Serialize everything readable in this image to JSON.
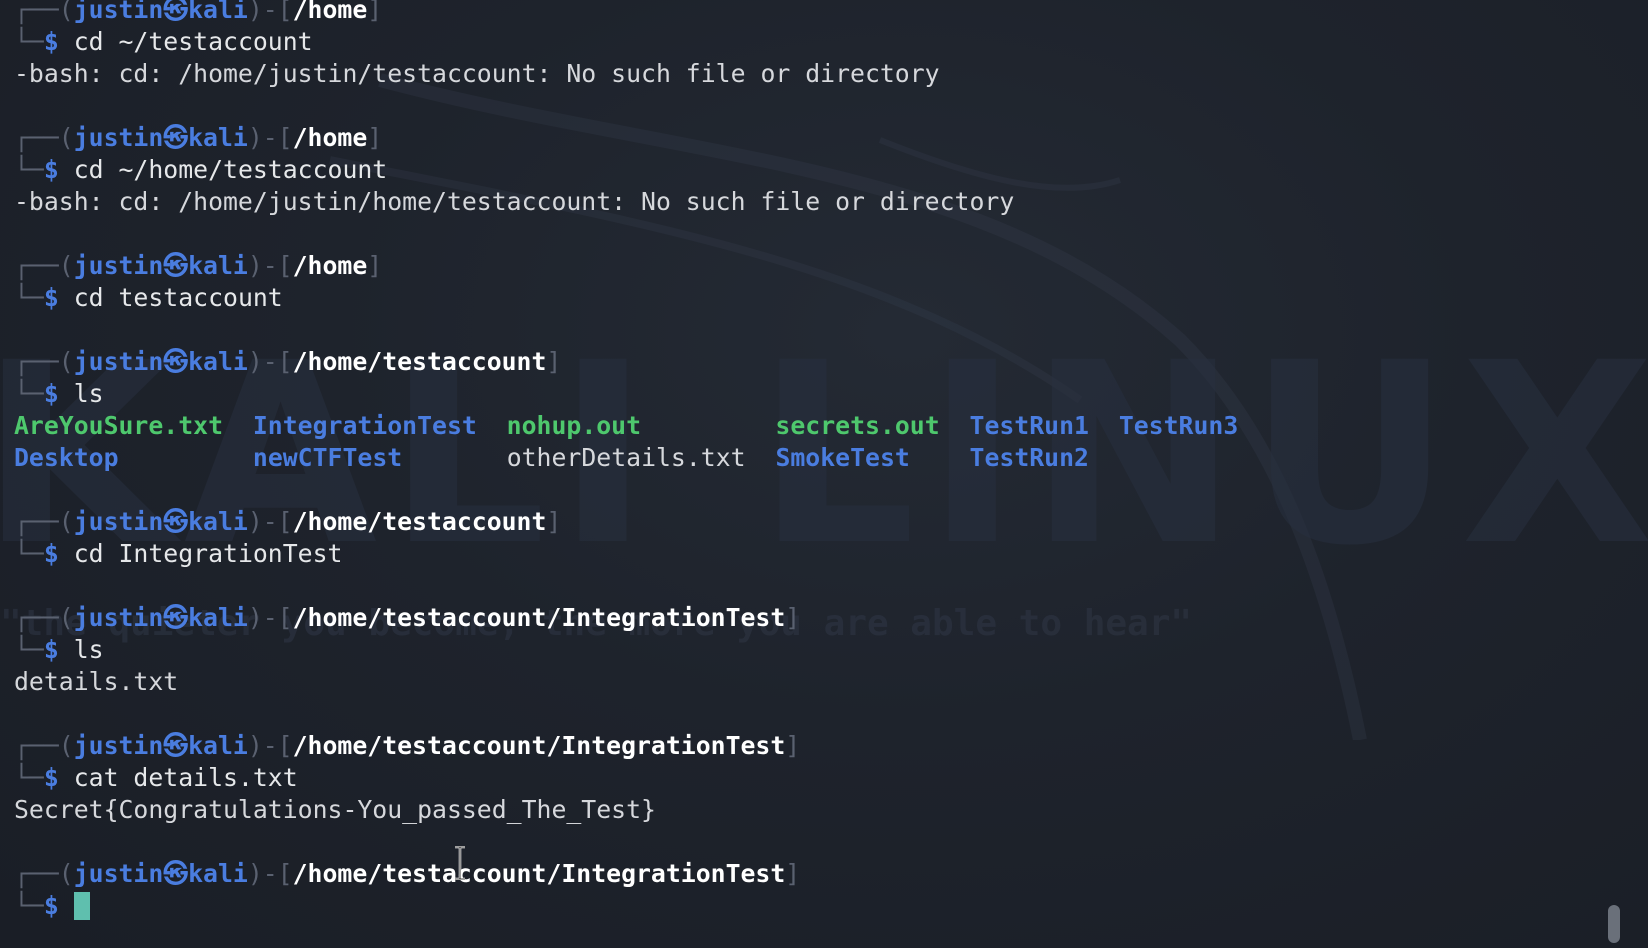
{
  "watermark": {
    "logo_text": "KALI LINUX",
    "quote": "\"the quieter you become, the more you are able to hear\""
  },
  "prompt": {
    "user": "justin",
    "at_symbol": "㉿",
    "host": "kali"
  },
  "blocks": [
    {
      "path": "/home",
      "command": "cd ~/testaccount",
      "output": [
        "-bash: cd: /home/justin/testaccount: No such file or directory"
      ]
    },
    {
      "path": "/home",
      "command": "cd ~/home/testaccount",
      "output": [
        "-bash: cd: /home/justin/home/testaccount: No such file or directory"
      ]
    },
    {
      "path": "/home",
      "command": "cd testaccount",
      "output": []
    },
    {
      "path": "/home/testaccount",
      "command": "ls",
      "output": []
    },
    {
      "path": "/home/testaccount",
      "command": "cd IntegrationTest",
      "output": []
    },
    {
      "path": "/home/testaccount/IntegrationTest",
      "command": "ls",
      "output": [
        "details.txt"
      ]
    },
    {
      "path": "/home/testaccount/IntegrationTest",
      "command": "cat details.txt",
      "output": [
        "Secret{Congratulations-You_passed_The_Test}"
      ]
    },
    {
      "path": "/home/testaccount/IntegrationTest",
      "command": "",
      "output": []
    }
  ],
  "ls_listing": {
    "row1": [
      "AreYouSure.txt",
      "IntegrationTest",
      "nohup.out",
      "secrets.out",
      "TestRun1",
      "TestRun3"
    ],
    "row2": [
      "Desktop",
      "newCTFTest",
      "otherDetails.txt",
      "SmokeTest",
      "TestRun2"
    ]
  },
  "colors": {
    "background": "#1b2029",
    "prompt_blue": "#4a7de0",
    "executable_green": "#4ec86d",
    "cursor": "#5fbfae"
  }
}
